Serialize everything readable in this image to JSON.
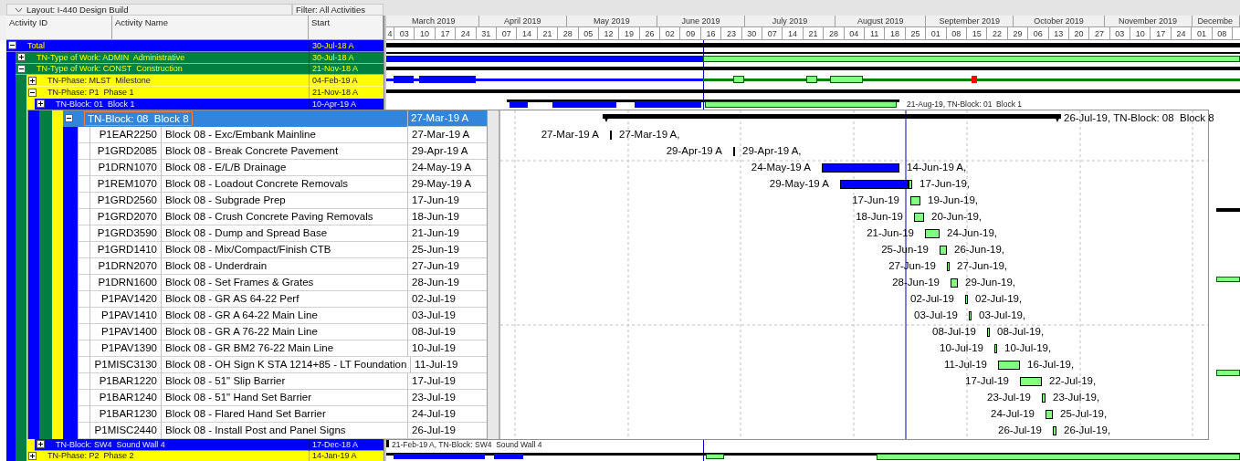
{
  "layout_bar": {
    "layout": "Layout: I-440 Design Build",
    "filter": "Filter: All Activities"
  },
  "columns": [
    "Activity ID",
    "Activity Name",
    "Start"
  ],
  "timescale": {
    "months": [
      "March 2019",
      "April 2019",
      "May 2019",
      "June 2019",
      "July 2019",
      "August 2019",
      "September 2019",
      "October 2019",
      "November 2019",
      "Decembe"
    ],
    "weeks": [
      "4",
      "03",
      "10",
      "17",
      "24",
      "31",
      "07",
      "14",
      "21",
      "28",
      "05",
      "12",
      "19",
      "26",
      "02",
      "09",
      "16",
      "23",
      "30",
      "07",
      "14",
      "21",
      "28",
      "04",
      "11",
      "18",
      "25",
      "01",
      "08",
      "15",
      "22",
      "29",
      "06",
      "13",
      "20",
      "27",
      "03",
      "10",
      "17",
      "24",
      "01",
      "08"
    ]
  },
  "wbs": [
    {
      "kind": "row",
      "label": "Total",
      "start": "30-Jul-18 A",
      "expanded": true,
      "selected": false,
      "children": [
        {
          "kind": "row",
          "label": "TN-Type of Work: ADMIN  Administrative",
          "start": "30-Jul-18 A",
          "expanded": false,
          "selected": false
        },
        {
          "kind": "row",
          "label": "TN-Type of Work: CONST  Construction",
          "start": "21-Nov-18 A",
          "expanded": true,
          "selected": false,
          "children": [
            {
              "kind": "row",
              "label": "TN-Phase: MLST  Milestone",
              "start": "04-Feb-19 A",
              "expanded": false,
              "selected": false
            },
            {
              "kind": "row",
              "label": "TN-Phase: P1  Phase 1",
              "start": "21-Nov-18 A",
              "expanded": true,
              "selected": false,
              "children": [
                {
                  "kind": "row",
                  "label": "TN-Block: 01  Block 1",
                  "start": "10-Apr-19 A",
                  "expanded": false,
                  "selected": false,
                  "bar_label": "21-Aug-19, TN-Block: 01  Block 1"
                },
                {
                  "kind": "magnified",
                  "label": "TN-Block: 08  Block 8",
                  "start": "27-Mar-19 A",
                  "expanded": true,
                  "selected": true,
                  "bar_label": "26-Jul-19, TN-Block: 08  Block 8",
                  "activities": [
                    {
                      "id": "P1EAR2250",
                      "name": "Block 08 - Exc/Embank Mainline",
                      "start": "27-Mar-19 A",
                      "bar_start": "27-Mar-19 A",
                      "bar_end": "27-Mar-19 A,",
                      "kind": "tick",
                      "selected": false
                    },
                    {
                      "id": "P1GRD2085",
                      "name": "Block 08 - Break Concrete Pavement",
                      "start": "29-Apr-19 A",
                      "bar_start": "29-Apr-19 A",
                      "bar_end": "29-Apr-19 A,",
                      "kind": "tick",
                      "selected": false
                    },
                    {
                      "id": "P1DRN1070",
                      "name": "Block 08 - E/L/B Drainage",
                      "start": "24-May-19 A",
                      "bar_start": "24-May-19 A",
                      "bar_end": "14-Jun-19 A,",
                      "kind": "actual",
                      "selected": false
                    },
                    {
                      "id": "P1REM1070",
                      "name": "Block 08 - Loadout Concrete Removals",
                      "start": "29-May-19 A",
                      "bar_start": "29-May-19 A",
                      "bar_end": "17-Jun-19,",
                      "kind": "split",
                      "selected": false
                    },
                    {
                      "id": "P1GRD2560",
                      "name": "Block 08 - Subgrade Prep",
                      "start": "17-Jun-19",
                      "bar_start": "17-Jun-19",
                      "bar_end": "19-Jun-19,",
                      "kind": "remaining",
                      "selected": false
                    },
                    {
                      "id": "P1GRD2070",
                      "name": "Block 08 - Crush Concrete Paving Removals",
                      "start": "18-Jun-19",
                      "bar_start": "18-Jun-19",
                      "bar_end": "20-Jun-19,",
                      "kind": "remaining",
                      "selected": false
                    },
                    {
                      "id": "P1GRD3590",
                      "name": "Block 08 - Dump and Spread Base",
                      "start": "21-Jun-19",
                      "bar_start": "21-Jun-19",
                      "bar_end": "24-Jun-19,",
                      "kind": "remaining",
                      "selected": false
                    },
                    {
                      "id": "P1GRD1410",
                      "name": "Block 08 - Mix/Compact/Finish CTB",
                      "start": "25-Jun-19",
                      "bar_start": "25-Jun-19",
                      "bar_end": "26-Jun-19,",
                      "kind": "remaining",
                      "selected": false
                    },
                    {
                      "id": "P1DRN2070",
                      "name": "Block 08 - Underdrain",
                      "start": "27-Jun-19",
                      "bar_start": "27-Jun-19",
                      "bar_end": "27-Jun-19,",
                      "kind": "remaining",
                      "selected": false
                    },
                    {
                      "id": "P1DRN1600",
                      "name": "Block 08 - Set Frames & Grates",
                      "start": "28-Jun-19",
                      "bar_start": "28-Jun-19",
                      "bar_end": "29-Jun-19,",
                      "kind": "remaining",
                      "selected": false
                    },
                    {
                      "id": "P1PAV1420",
                      "name": "Block 08 - GR AS 64-22 Perf",
                      "start": "02-Jul-19",
                      "bar_start": "02-Jul-19",
                      "bar_end": "02-Jul-19,",
                      "kind": "remaining",
                      "selected": false
                    },
                    {
                      "id": "P1PAV1410",
                      "name": "Block 08 - GR A 64-22 Main Line",
                      "start": "03-Jul-19",
                      "bar_start": "03-Jul-19",
                      "bar_end": "03-Jul-19,",
                      "kind": "remaining",
                      "selected": false
                    },
                    {
                      "id": "P1PAV1400",
                      "name": "Block 08 - GR A 76-22 Main Line",
                      "start": "08-Jul-19",
                      "bar_start": "08-Jul-19",
                      "bar_end": "08-Jul-19,",
                      "kind": "remaining",
                      "selected": false
                    },
                    {
                      "id": "P1PAV1390",
                      "name": "Block 08 - GR BM2 76-22 Main Line",
                      "start": "10-Jul-19",
                      "bar_start": "10-Jul-19",
                      "bar_end": "10-Jul-19,",
                      "kind": "remaining",
                      "selected": false
                    },
                    {
                      "id": "P1MISC3130",
                      "name": "Block 08 - OH Sign K STA 1214+85 - LT Foundation",
                      "start": "11-Jul-19",
                      "bar_start": "11-Jul-19",
                      "bar_end": "16-Jul-19,",
                      "kind": "remaining",
                      "selected": false
                    },
                    {
                      "id": "P1BAR1220",
                      "name": "Block 08 - 51\" Slip Barrier",
                      "start": "17-Jul-19",
                      "bar_start": "17-Jul-19",
                      "bar_end": "22-Jul-19,",
                      "kind": "remaining",
                      "selected": false
                    },
                    {
                      "id": "P1BAR1240",
                      "name": "Block 08 - 51\" Hand Set Barrier",
                      "start": "23-Jul-19",
                      "bar_start": "23-Jul-19",
                      "bar_end": "23-Jul-19,",
                      "kind": "remaining",
                      "selected": false
                    },
                    {
                      "id": "P1BAR1230",
                      "name": "Block 08 - Flared Hand Set Barrier",
                      "start": "24-Jul-19",
                      "bar_start": "24-Jul-19",
                      "bar_end": "25-Jul-19,",
                      "kind": "remaining",
                      "selected": false
                    },
                    {
                      "id": "P1MISC2440",
                      "name": "Block 08 - Install Post and Panel Signs",
                      "start": "26-Jul-19",
                      "bar_start": "26-Jul-19",
                      "bar_end": "26-Jul-19,",
                      "kind": "remaining",
                      "selected": false
                    }
                  ]
                },
                {
                  "kind": "row",
                  "label": "TN-Block: SW4  Sound Wall 4",
                  "start": "17-Dec-18 A",
                  "expanded": false,
                  "selected": false,
                  "bar_label": "21-Feb-19 A, TN-Block: SW4  Sound Wall 4"
                }
              ]
            },
            {
              "kind": "row",
              "label": "TN-Phase: P2  Phase 2",
              "start": "14-Jan-19 A",
              "expanded": false,
              "selected": false
            }
          ]
        }
      ]
    }
  ]
}
